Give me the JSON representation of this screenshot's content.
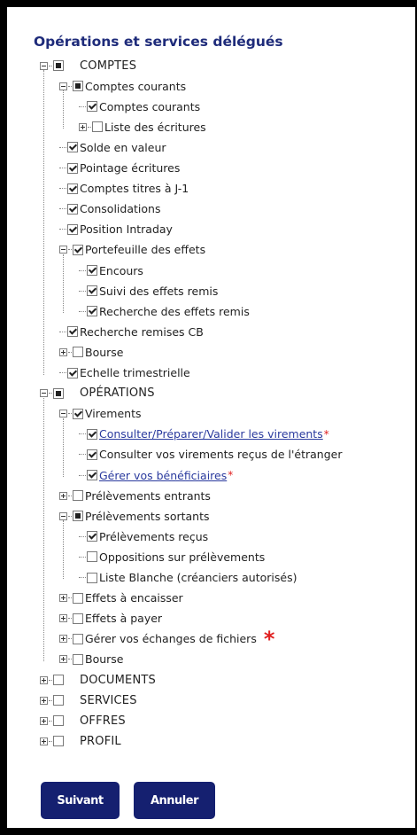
{
  "title": "Opérations et services délégués",
  "tree": [
    {
      "key": "comptes",
      "label": "COMPTES",
      "level": 0,
      "expander": "minus",
      "state": "partial",
      "category": true
    },
    {
      "key": "comptes-courants",
      "label": "Comptes courants",
      "level": 1,
      "expander": "minus",
      "state": "partial"
    },
    {
      "key": "comptes-courants-sub",
      "label": "Comptes courants",
      "level": 2,
      "expander": "none",
      "state": "checked"
    },
    {
      "key": "liste-ecritures",
      "label": "Liste des écritures",
      "level": 2,
      "expander": "plus",
      "state": "unchecked"
    },
    {
      "key": "solde-valeur",
      "label": "Solde en valeur",
      "level": 1,
      "expander": "none",
      "state": "checked"
    },
    {
      "key": "pointage-ecritures",
      "label": "Pointage écritures",
      "level": 1,
      "expander": "none",
      "state": "checked"
    },
    {
      "key": "comptes-titres",
      "label": "Comptes titres à J-1",
      "level": 1,
      "expander": "none",
      "state": "checked"
    },
    {
      "key": "consolidations",
      "label": "Consolidations",
      "level": 1,
      "expander": "none",
      "state": "checked"
    },
    {
      "key": "position-intraday",
      "label": "Position Intraday",
      "level": 1,
      "expander": "none",
      "state": "checked"
    },
    {
      "key": "portefeuille-effets",
      "label": "Portefeuille des effets",
      "level": 1,
      "expander": "minus",
      "state": "checked"
    },
    {
      "key": "encours",
      "label": "Encours",
      "level": 2,
      "expander": "none",
      "state": "checked"
    },
    {
      "key": "suivi-effets-remis",
      "label": "Suivi des effets remis",
      "level": 2,
      "expander": "none",
      "state": "checked"
    },
    {
      "key": "recherche-effets-remis",
      "label": "Recherche des effets remis",
      "level": 2,
      "expander": "none",
      "state": "checked"
    },
    {
      "key": "recherche-remises-cb",
      "label": "Recherche remises CB",
      "level": 1,
      "expander": "none",
      "state": "checked"
    },
    {
      "key": "bourse-comptes",
      "label": "Bourse",
      "level": 1,
      "expander": "plus",
      "state": "unchecked"
    },
    {
      "key": "echelle-trimestrielle",
      "label": "Echelle trimestrielle",
      "level": 1,
      "expander": "none",
      "state": "checked"
    },
    {
      "key": "operations",
      "label": "OPÉRATIONS",
      "level": 0,
      "expander": "minus",
      "state": "partial",
      "category": true
    },
    {
      "key": "virements",
      "label": "Virements",
      "level": 1,
      "expander": "minus",
      "state": "checked"
    },
    {
      "key": "consulter-virements",
      "label": "Consulter/Préparer/Valider les virements",
      "level": 2,
      "expander": "none",
      "state": "checked",
      "link": true,
      "star": "*"
    },
    {
      "key": "virements-etranger",
      "label": "Consulter vos virements reçus de l'étranger",
      "level": 2,
      "expander": "none",
      "state": "checked"
    },
    {
      "key": "gerer-beneficiaires",
      "label": "Gérer vos bénéficiaires",
      "level": 2,
      "expander": "none",
      "state": "checked",
      "link": true,
      "star": "*"
    },
    {
      "key": "prelevements-entrants",
      "label": "Prélèvements entrants",
      "level": 1,
      "expander": "plus",
      "state": "unchecked"
    },
    {
      "key": "prelevements-sortants",
      "label": "Prélèvements sortants",
      "level": 1,
      "expander": "minus",
      "state": "partial"
    },
    {
      "key": "prelevements-recus",
      "label": "Prélèvements reçus",
      "level": 2,
      "expander": "none",
      "state": "checked"
    },
    {
      "key": "oppositions-prelevements",
      "label": "Oppositions sur prélèvements",
      "level": 2,
      "expander": "none",
      "state": "unchecked"
    },
    {
      "key": "liste-blanche",
      "label": "Liste Blanche (créanciers autorisés)",
      "level": 2,
      "expander": "none",
      "state": "unchecked"
    },
    {
      "key": "effets-encaisser",
      "label": "Effets à encaisser",
      "level": 1,
      "expander": "plus",
      "state": "unchecked"
    },
    {
      "key": "effets-payer",
      "label": "Effets à payer",
      "level": 1,
      "expander": "plus",
      "state": "unchecked"
    },
    {
      "key": "echanges-fichiers",
      "label": "Gérer vos échanges de fichiers",
      "level": 1,
      "expander": "plus",
      "state": "unchecked",
      "bigstar": "*"
    },
    {
      "key": "bourse-operations",
      "label": "Bourse",
      "level": 1,
      "expander": "plus",
      "state": "unchecked"
    },
    {
      "key": "documents",
      "label": "DOCUMENTS",
      "level": 0,
      "expander": "plus",
      "state": "unchecked",
      "category": true
    },
    {
      "key": "services",
      "label": "SERVICES",
      "level": 0,
      "expander": "plus",
      "state": "unchecked",
      "category": true
    },
    {
      "key": "offres",
      "label": "OFFRES",
      "level": 0,
      "expander": "plus",
      "state": "unchecked",
      "category": true
    },
    {
      "key": "profil",
      "label": "PROFIL",
      "level": 0,
      "expander": "plus",
      "state": "unchecked",
      "category": true
    }
  ],
  "buttons": {
    "next": "Suivant",
    "cancel": "Annuler"
  },
  "colors": {
    "accent": "#1e2b7a",
    "button": "#152070",
    "required": "#e02020",
    "link": "#2a3a9e"
  }
}
